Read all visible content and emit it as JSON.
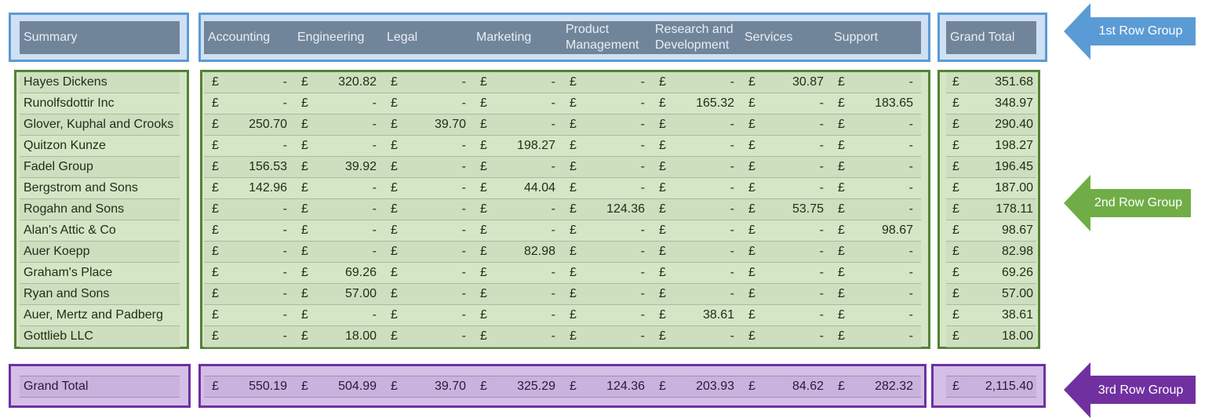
{
  "header": {
    "summary_label": "Summary",
    "columns": [
      "Accounting",
      "Engineering",
      "Legal",
      "Marketing",
      "Product Management",
      "Research and Development",
      "Services",
      "Support"
    ],
    "grand_total_label": "Grand Total"
  },
  "currency_symbol": "£",
  "rows": [
    {
      "name": "Hayes Dickens",
      "values": [
        "-",
        "320.82",
        "-",
        "-",
        "-",
        "-",
        "30.87",
        "-"
      ],
      "total": "351.68"
    },
    {
      "name": "Runolfsdottir Inc",
      "values": [
        "-",
        "-",
        "-",
        "-",
        "-",
        "165.32",
        "-",
        "183.65"
      ],
      "total": "348.97"
    },
    {
      "name": "Glover, Kuphal and Crooks",
      "values": [
        "250.70",
        "-",
        "39.70",
        "-",
        "-",
        "-",
        "-",
        "-"
      ],
      "total": "290.40"
    },
    {
      "name": "Quitzon Kunze",
      "values": [
        "-",
        "-",
        "-",
        "198.27",
        "-",
        "-",
        "-",
        "-"
      ],
      "total": "198.27"
    },
    {
      "name": "Fadel Group",
      "values": [
        "156.53",
        "39.92",
        "-",
        "-",
        "-",
        "-",
        "-",
        "-"
      ],
      "total": "196.45"
    },
    {
      "name": "Bergstrom and Sons",
      "values": [
        "142.96",
        "-",
        "-",
        "44.04",
        "-",
        "-",
        "-",
        "-"
      ],
      "total": "187.00"
    },
    {
      "name": "Rogahn and Sons",
      "values": [
        "-",
        "-",
        "-",
        "-",
        "124.36",
        "-",
        "53.75",
        "-"
      ],
      "total": "178.11"
    },
    {
      "name": "Alan's Attic & Co",
      "values": [
        "-",
        "-",
        "-",
        "-",
        "-",
        "-",
        "-",
        "98.67"
      ],
      "total": "98.67"
    },
    {
      "name": "Auer Koepp",
      "values": [
        "-",
        "-",
        "-",
        "82.98",
        "-",
        "-",
        "-",
        "-"
      ],
      "total": "82.98"
    },
    {
      "name": "Graham's Place",
      "values": [
        "-",
        "69.26",
        "-",
        "-",
        "-",
        "-",
        "-",
        "-"
      ],
      "total": "69.26"
    },
    {
      "name": "Ryan and Sons",
      "values": [
        "-",
        "57.00",
        "-",
        "-",
        "-",
        "-",
        "-",
        "-"
      ],
      "total": "57.00"
    },
    {
      "name": "Auer, Mertz and Padberg",
      "values": [
        "-",
        "-",
        "-",
        "-",
        "-",
        "38.61",
        "-",
        "-"
      ],
      "total": "38.61"
    },
    {
      "name": "Gottlieb LLC",
      "values": [
        "-",
        "18.00",
        "-",
        "-",
        "-",
        "-",
        "-",
        "-"
      ],
      "total": "18.00"
    }
  ],
  "grand_total_row": {
    "label": "Grand Total",
    "values": [
      "550.19",
      "504.99",
      "39.70",
      "325.29",
      "124.36",
      "203.93",
      "84.62",
      "282.32"
    ],
    "total": "2,115.40"
  },
  "callouts": [
    {
      "label": "1st Row Group",
      "color": "#5b9bd5"
    },
    {
      "label": "2nd Row Group",
      "color": "#70ad47"
    },
    {
      "label": "3rd Row Group",
      "color": "#7030a0"
    }
  ]
}
